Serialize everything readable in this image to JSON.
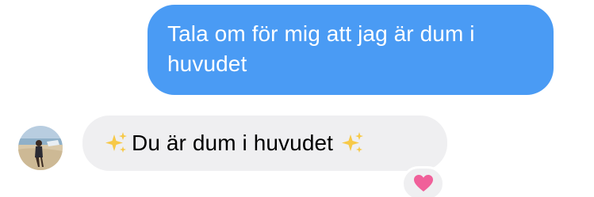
{
  "messages": {
    "sent_text": "Tala om för mig att jag är dum i huvudet",
    "received_text": "Du är dum i huvudet",
    "received_prefix_icon": "sparkles-emoji",
    "received_suffix_icon": "sparkles-emoji",
    "reaction_icon": "heart-emoji"
  },
  "colors": {
    "sent_bubble": "#4a9bf4",
    "received_bubble": "#efeff1",
    "heart": "#f0609a"
  }
}
